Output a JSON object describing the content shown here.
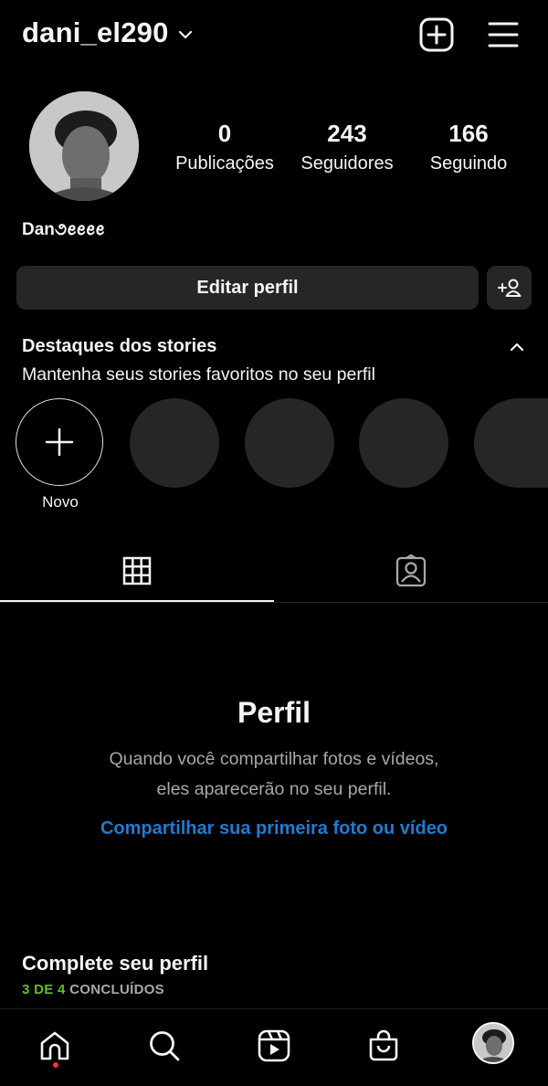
{
  "header": {
    "username": "dani_el290",
    "icons": [
      "chevron-down-icon",
      "new-post-icon",
      "menu-icon"
    ]
  },
  "profile": {
    "display_name": "Dan૭ꫀꫀꫀꫀ",
    "stats": [
      {
        "value": "0",
        "label": "Publicações"
      },
      {
        "value": "243",
        "label": "Seguidores"
      },
      {
        "value": "166",
        "label": "Seguindo"
      }
    ]
  },
  "actions": {
    "edit_profile": "Editar perfil",
    "add_user_icon": "add-user-icon"
  },
  "highlights": {
    "title": "Destaques dos stories",
    "subtitle": "Mantenha seus stories favoritos no seu perfil",
    "new_label": "Novo"
  },
  "tabs": [
    {
      "icon": "grid-icon",
      "active": true
    },
    {
      "icon": "tagged-icon",
      "active": false
    }
  ],
  "empty_state": {
    "title": "Perfil",
    "description": "Quando você compartilhar fotos e vídeos, eles aparecerão no seu perfil.",
    "link": "Compartilhar sua primeira foto ou vídeo"
  },
  "complete_profile": {
    "title": "Complete seu perfil",
    "progress_done": "3 DE 4",
    "progress_label": "CONCLUÍDOS"
  },
  "bottom_nav": [
    "home-icon",
    "search-icon",
    "reels-icon",
    "shop-icon",
    "profile-avatar"
  ],
  "colors": {
    "background": "#000000",
    "surface": "#262626",
    "link": "#1f7bd1",
    "progress": "#58c322",
    "notification_dot": "#ff3040"
  }
}
